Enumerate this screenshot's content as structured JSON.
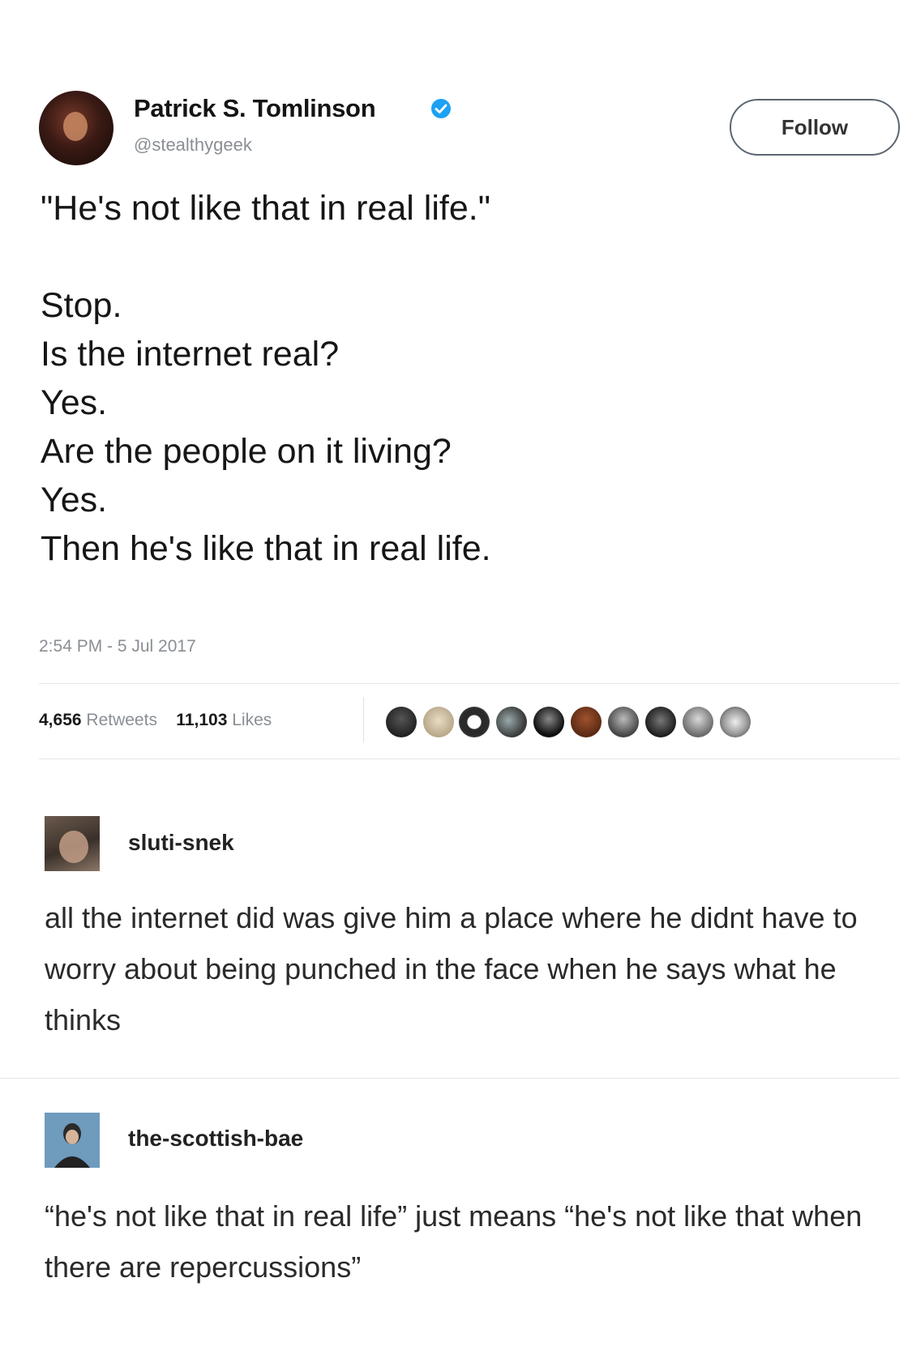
{
  "tweet": {
    "author_name": "Patrick S. Tomlinson",
    "author_handle": "@stealthygeek",
    "follow_label": "Follow",
    "lines": [
      "\"He's not like that in real life.\"",
      "Stop.",
      "Is the internet real?",
      "Yes.",
      "Are the people on it living?",
      "Yes.",
      "Then he's like that in real life."
    ],
    "timestamp": "2:54 PM - 5 Jul 2017",
    "retweets_count": "4,656",
    "retweets_label": "Retweets",
    "likes_count": "11,103",
    "likes_label": "Likes"
  },
  "reblogs": [
    {
      "username": "sluti-snek",
      "text": "all the internet did was give him a place where he didnt have to worry about being punched in the face when he says what he thinks"
    },
    {
      "username": "the-scottish-bae",
      "text": "“he's not like that in real life” just means “he's not like that when there are repercussions”"
    }
  ]
}
